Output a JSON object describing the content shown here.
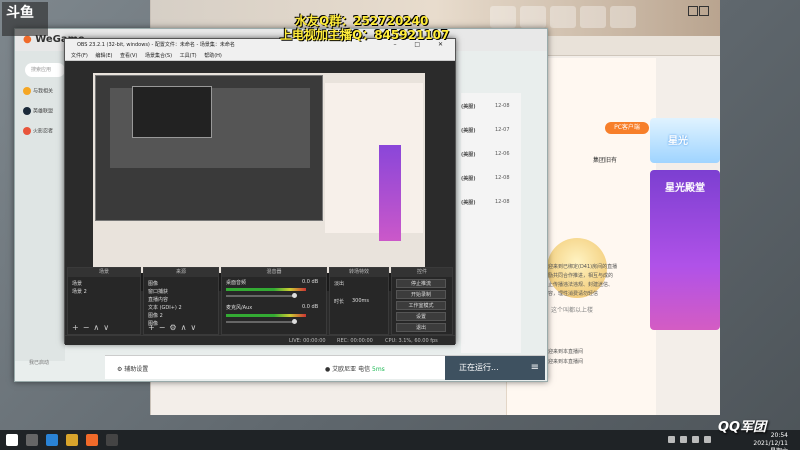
{
  "overlay": {
    "logo_text": "斗鱼",
    "line1": "水友Q群：252720240",
    "line2": "上电视加主播Q：845921107",
    "corner_watermark": "QQ军团"
  },
  "wegame": {
    "logo": "WeGame",
    "search_placeholder": "搜索应用",
    "sidebar_items": [
      "与我相关",
      "英雄联盟",
      "火影忍者"
    ],
    "sidebar_bottom": "我已启动",
    "bottom_bar": {
      "assist_label": "辅助设置",
      "hero_label": "艾欧尼亚 电信",
      "hero_tag": "5ms",
      "running_label": "正在运行..."
    },
    "right_list": [
      {
        "label": "(美服)",
        "date": "12-08"
      },
      {
        "label": "(美服)",
        "date": "12-07"
      },
      {
        "label": "(美服)",
        "date": "12-06"
      },
      {
        "label": "(美服)",
        "date": "12-08"
      },
      {
        "label": "(美服)",
        "date": "12-08"
      }
    ]
  },
  "bg_browser": {
    "pc_badge": "PC客户端",
    "followers_label": "集团旧有",
    "follow_text": "这个叫都以上楼",
    "chat_lines": [
      "欢迎来到已绑定(D41)房间的直播",
      "鼓励共同合作推进，相互与成的",
      "禁止传播违法违规、封建迷信、",
      "内容，理性消费请勿轻信",
      "欢迎来到本直播间",
      "欢迎来到本直播间"
    ],
    "banner_text": "星光殿堂",
    "badge_label": "星光"
  },
  "obs": {
    "title": "OBS 23.2.1 (32-bit, windows) - 配置文件：未命名 - 场景集：未命名",
    "menu": [
      "文件(F)",
      "编辑(E)",
      "查看(V)",
      "场景集合(S)",
      "工具(T)",
      "帮助(H)"
    ],
    "docks": {
      "scenes": {
        "title": "场景",
        "items": [
          "场景",
          "场景 2"
        ]
      },
      "sources": {
        "title": "来源",
        "items": [
          "图像",
          "窗口捕获",
          "直播内容",
          "文本 (GDI+) 2",
          "图像 2",
          "图像"
        ]
      },
      "mixer": {
        "title": "混音器",
        "desktop": "桌面音频",
        "mic": "麦克风/Aux",
        "db1": "0.0 dB",
        "db2": "0.0 dB"
      },
      "transitions": {
        "title": "转场特效",
        "fade": "淡出",
        "duration_label": "时长",
        "duration_value": "300ms"
      },
      "controls": {
        "title": "控件",
        "buttons": [
          "停止推流",
          "开始录制",
          "工作室模式",
          "设置",
          "退出"
        ]
      }
    },
    "status": {
      "live": "LIVE: 00:00:00",
      "rec": "REC: 00:00:00",
      "cpu": "CPU: 3.1%, 60.00 fps"
    }
  },
  "taskbar": {
    "time": "20:54",
    "date": "2021/12/11 星期六"
  },
  "colors": {
    "obs_bg": "#2b2b2b",
    "running_btn": "#3e5160",
    "overlay_text": "#ffec3a",
    "purple_banner": "#7c3fd1"
  }
}
